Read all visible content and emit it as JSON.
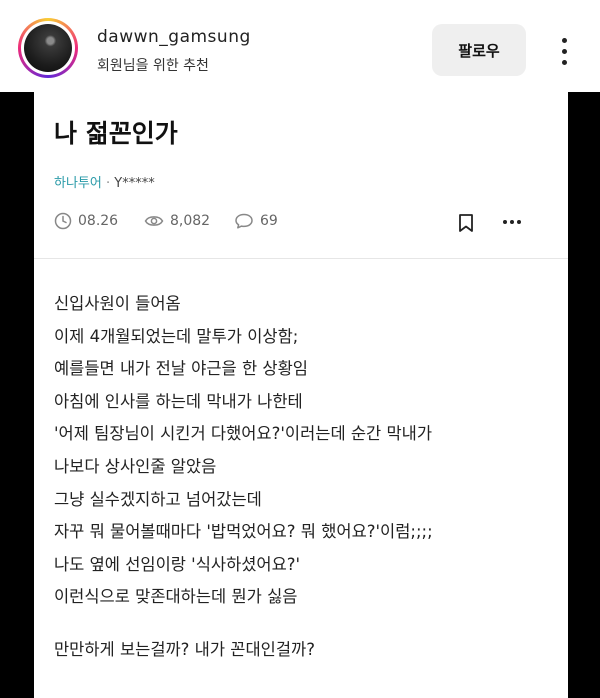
{
  "header": {
    "username": "dawwn_gamsung",
    "subtitle": "회원님을 위한 추천",
    "follow_label": "팔로우"
  },
  "post": {
    "title": "나 젊꼰인가",
    "board": "하나투어",
    "separator": "·",
    "author": "Y*****",
    "date": "08.26",
    "views": "8,082",
    "comments": "69",
    "lines": [
      "신입사원이 들어옴",
      "이제 4개월되었는데 말투가 이상함;",
      "예를들면 내가 전날 야근을 한 상황임",
      "아침에 인사를 하는데 막내가 나한테",
      "'어제 팀장님이 시킨거 다했어요?'이러는데 순간 막내가",
      "나보다 상사인줄 알았음",
      "그냥 실수겠지하고 넘어갔는데",
      "자꾸 뭐 물어볼때마다 '밥먹었어요? 뭐 했어요?'이럼;;;;",
      "나도 옆에 선임이랑 '식사하셨어요?'",
      "이런식으로 맞존대하는데 뭔가 싫음"
    ],
    "closing_line": "만만하게 보는걸까? 내가 꼰대인걸까?"
  },
  "icons": {
    "clock": "clock-icon",
    "views": "eye-icon",
    "comments": "comment-icon",
    "bookmark": "bookmark-icon",
    "more": "more-icon"
  },
  "colors": {
    "board": "#2a9aa8",
    "follow_bg": "#efefef",
    "side_bars": "#000000"
  }
}
